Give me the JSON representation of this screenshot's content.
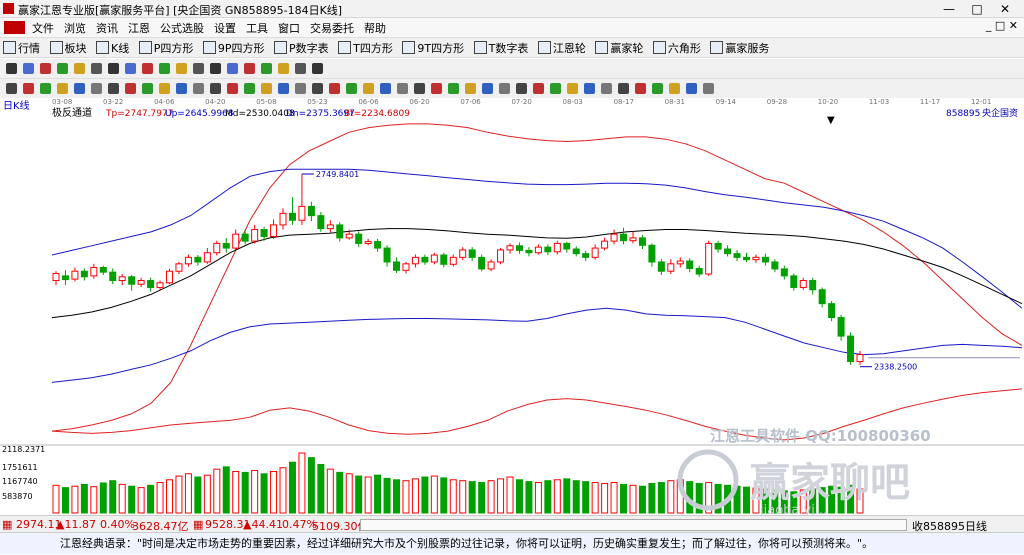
{
  "window": {
    "title": "赢家江恩专业版[赢家服务平台]  [央企国资  GN858895-184日K线]"
  },
  "menu": {
    "items": [
      "文件",
      "浏览",
      "资讯",
      "江恩",
      "公式选股",
      "设置",
      "工具",
      "窗口",
      "交易委托",
      "帮助"
    ]
  },
  "toolbar1": {
    "items": [
      "行情",
      "板块",
      "K线",
      "P四方形",
      "9P四方形",
      "P数字表",
      "T四方形",
      "9T四方形",
      "T数字表",
      "江恩轮",
      "赢家轮",
      "六角形",
      "赢家服务"
    ]
  },
  "colors": {
    "up": "#ff0000",
    "down": "#00a000",
    "band_outer": "#e02020",
    "band_inner": "#1818c8",
    "mid": "#000000",
    "info_tp": "#d40000",
    "info_up": "#0000d0",
    "info_md": "#000000",
    "info_dn": "#0000d0",
    "info_bt": "#d40000",
    "code": "#0000b0"
  },
  "header": {
    "period": "日K线",
    "indicator": "极反通道",
    "tp": "Tp=2747.7977",
    "up": "Up=2645.9968",
    "md": "Md=2530.0408",
    "dn": "Dn=2375.3697",
    "bt": "Bt=2234.6809",
    "code": "858895",
    "name": "央企国资"
  },
  "watermark": {
    "line1": "江恩工具软件 QQ:100800360",
    "line2": "赢家聊吧",
    "line3": "jiaoba.yj..."
  },
  "statusbar": {
    "idx1_value": "2974.11",
    "idx1_change": "▲11.87",
    "idx1_pct": "0.40%",
    "idx1_amount": "3628.47亿",
    "idx2_value": "9528.31",
    "idx2_change": "▲44.41",
    "idx2_pct": "0.47%",
    "idx2_amount": "5109.30亿",
    "right_label": "收858895日线"
  },
  "quote": {
    "text": "江恩经典语录：\"时间是决定市场走势的重要因素，经过详细研究大市及个别股票的过往记录，你将可以证明，历史确实重复发生；而了解过往，你将可以预测将来。\"。"
  },
  "chart_data": {
    "type": "candlestick",
    "date_ticks": [
      "03-08",
      "03-22",
      "04-06",
      "04-20",
      "05-08",
      "05-23",
      "06-06",
      "06-20",
      "07-06",
      "07-20",
      "08-03",
      "08-17",
      "08-31",
      "09-14",
      "09-28",
      "10-20",
      "11-03",
      "11-17",
      "12-01"
    ],
    "y_range": [
      2180,
      2860
    ],
    "price_annotations": [
      {
        "label": "2749.8401",
        "value": 2749.8401
      },
      {
        "label": "2338.2500",
        "value": 2338.25
      }
    ],
    "volume_axis_labels": [
      "2118.2371",
      "1751611",
      "1167740",
      "583870"
    ],
    "volume_max": 2118000,
    "series_tp": [
      2195,
      2200,
      2208,
      2218,
      2232,
      2255,
      2300,
      2380,
      2470,
      2560,
      2650,
      2720,
      2770,
      2800,
      2820,
      2840,
      2850,
      2855,
      2858,
      2858,
      2855,
      2850,
      2840,
      2832,
      2826,
      2822,
      2820,
      2822,
      2826,
      2830,
      2830,
      2825,
      2815,
      2800,
      2780,
      2760,
      2740,
      2730,
      2710,
      2690,
      2670,
      2650,
      2625,
      2595,
      2560,
      2520,
      2480,
      2440,
      2405,
      2380
    ],
    "series_up": [
      2575,
      2585,
      2595,
      2605,
      2615,
      2625,
      2640,
      2660,
      2690,
      2720,
      2745,
      2755,
      2760,
      2760,
      2760,
      2760,
      2758,
      2754,
      2750,
      2746,
      2742,
      2738,
      2734,
      2731,
      2728,
      2727,
      2727,
      2728,
      2730,
      2730,
      2729,
      2726,
      2720,
      2712,
      2705,
      2700,
      2694,
      2688,
      2683,
      2678,
      2670,
      2660,
      2648,
      2630,
      2612,
      2590,
      2560,
      2528,
      2495,
      2460
    ],
    "series_md": [
      2440,
      2445,
      2452,
      2462,
      2475,
      2490,
      2510,
      2530,
      2555,
      2580,
      2600,
      2612,
      2618,
      2620,
      2622,
      2626,
      2630,
      2632,
      2632,
      2630,
      2627,
      2623,
      2620,
      2618,
      2615,
      2612,
      2611,
      2614,
      2620,
      2625,
      2628,
      2630,
      2630,
      2628,
      2625,
      2622,
      2620,
      2618,
      2615,
      2610,
      2605,
      2598,
      2588,
      2575,
      2562,
      2548,
      2530,
      2510,
      2490,
      2470
    ],
    "series_dn": [
      2300,
      2305,
      2310,
      2318,
      2328,
      2338,
      2352,
      2368,
      2390,
      2408,
      2420,
      2426,
      2428,
      2430,
      2432,
      2434,
      2436,
      2437,
      2438,
      2438,
      2437,
      2436,
      2435,
      2433,
      2432,
      2438,
      2448,
      2456,
      2460,
      2456,
      2448,
      2445,
      2444,
      2442,
      2440,
      2430,
      2415,
      2400,
      2385,
      2375,
      2365,
      2360,
      2362,
      2368,
      2374,
      2380,
      2382,
      2380,
      2378,
      2375
    ],
    "series_bt": [
      2195,
      2192,
      2190,
      2192,
      2196,
      2202,
      2208,
      2212,
      2215,
      2218,
      2225,
      2240,
      2245,
      2238,
      2225,
      2208,
      2196,
      2190,
      2188,
      2190,
      2195,
      2205,
      2218,
      2238,
      2252,
      2262,
      2265,
      2262,
      2255,
      2248,
      2240,
      2230,
      2218,
      2205,
      2195,
      2186,
      2180,
      2176,
      2180,
      2190,
      2205,
      2218,
      2232,
      2245,
      2255,
      2264,
      2272,
      2278,
      2282,
      2286
    ],
    "candles": [
      [
        2520,
        2535,
        2510,
        2540
      ],
      [
        2530,
        2522,
        2510,
        2542
      ],
      [
        2523,
        2540,
        2518,
        2548
      ],
      [
        2540,
        2528,
        2520,
        2546
      ],
      [
        2530,
        2548,
        2524,
        2556
      ],
      [
        2548,
        2538,
        2532,
        2552
      ],
      [
        2538,
        2520,
        2512,
        2546
      ],
      [
        2520,
        2528,
        2510,
        2534
      ],
      [
        2528,
        2512,
        2498,
        2532
      ],
      [
        2512,
        2520,
        2506,
        2526
      ],
      [
        2520,
        2505,
        2496,
        2526
      ],
      [
        2505,
        2515,
        2500,
        2520
      ],
      [
        2515,
        2540,
        2512,
        2545
      ],
      [
        2540,
        2556,
        2534,
        2560
      ],
      [
        2556,
        2570,
        2550,
        2576
      ],
      [
        2570,
        2560,
        2552,
        2575
      ],
      [
        2560,
        2580,
        2556,
        2590
      ],
      [
        2580,
        2600,
        2574,
        2606
      ],
      [
        2600,
        2590,
        2580,
        2612
      ],
      [
        2590,
        2620,
        2586,
        2630
      ],
      [
        2620,
        2605,
        2598,
        2630
      ],
      [
        2605,
        2630,
        2600,
        2640
      ],
      [
        2630,
        2615,
        2606,
        2636
      ],
      [
        2615,
        2640,
        2610,
        2652
      ],
      [
        2640,
        2665,
        2630,
        2676
      ],
      [
        2665,
        2650,
        2640,
        2700
      ],
      [
        2650,
        2680,
        2640,
        2750
      ],
      [
        2680,
        2660,
        2648,
        2690
      ],
      [
        2660,
        2632,
        2625,
        2668
      ],
      [
        2632,
        2640,
        2624,
        2650
      ],
      [
        2640,
        2612,
        2604,
        2646
      ],
      [
        2612,
        2620,
        2608,
        2630
      ],
      [
        2620,
        2600,
        2592,
        2626
      ],
      [
        2600,
        2604,
        2596,
        2610
      ],
      [
        2604,
        2590,
        2582,
        2610
      ],
      [
        2590,
        2560,
        2550,
        2596
      ],
      [
        2560,
        2542,
        2536,
        2570
      ],
      [
        2542,
        2556,
        2535,
        2560
      ],
      [
        2556,
        2570,
        2548,
        2576
      ],
      [
        2570,
        2560,
        2554,
        2576
      ],
      [
        2560,
        2575,
        2555,
        2580
      ],
      [
        2575,
        2555,
        2548,
        2580
      ],
      [
        2555,
        2570,
        2550,
        2576
      ],
      [
        2570,
        2586,
        2564,
        2592
      ],
      [
        2586,
        2570,
        2562,
        2592
      ],
      [
        2570,
        2545,
        2540,
        2576
      ],
      [
        2545,
        2560,
        2540,
        2566
      ],
      [
        2560,
        2586,
        2555,
        2590
      ],
      [
        2586,
        2595,
        2578,
        2600
      ],
      [
        2595,
        2585,
        2578,
        2602
      ],
      [
        2585,
        2580,
        2572,
        2592
      ],
      [
        2580,
        2592,
        2576,
        2598
      ],
      [
        2592,
        2582,
        2575,
        2598
      ],
      [
        2582,
        2600,
        2576,
        2606
      ],
      [
        2600,
        2588,
        2580,
        2604
      ],
      [
        2588,
        2578,
        2572,
        2594
      ],
      [
        2578,
        2570,
        2562,
        2584
      ],
      [
        2570,
        2590,
        2565,
        2598
      ],
      [
        2590,
        2605,
        2585,
        2612
      ],
      [
        2605,
        2620,
        2598,
        2630
      ],
      [
        2620,
        2606,
        2598,
        2634
      ],
      [
        2606,
        2612,
        2600,
        2626
      ],
      [
        2612,
        2596,
        2588,
        2618
      ],
      [
        2596,
        2560,
        2550,
        2600
      ],
      [
        2560,
        2540,
        2532,
        2566
      ],
      [
        2540,
        2556,
        2534,
        2566
      ],
      [
        2556,
        2562,
        2548,
        2570
      ],
      [
        2562,
        2546,
        2538,
        2568
      ],
      [
        2546,
        2534,
        2528,
        2552
      ],
      [
        2534,
        2600,
        2530,
        2606
      ],
      [
        2600,
        2588,
        2580,
        2606
      ],
      [
        2588,
        2578,
        2572,
        2596
      ],
      [
        2578,
        2570,
        2562,
        2586
      ],
      [
        2570,
        2565,
        2560,
        2580
      ],
      [
        2565,
        2570,
        2558,
        2576
      ],
      [
        2570,
        2560,
        2552,
        2578
      ],
      [
        2560,
        2545,
        2538,
        2566
      ],
      [
        2545,
        2530,
        2522,
        2552
      ],
      [
        2530,
        2505,
        2498,
        2535
      ],
      [
        2505,
        2520,
        2500,
        2526
      ],
      [
        2520,
        2500,
        2490,
        2526
      ],
      [
        2500,
        2470,
        2462,
        2505
      ],
      [
        2470,
        2440,
        2432,
        2476
      ],
      [
        2440,
        2400,
        2390,
        2446
      ],
      [
        2400,
        2345,
        2338,
        2408
      ],
      [
        2345,
        2360,
        2338,
        2368
      ]
    ],
    "volumes": [
      60,
      55,
      58,
      62,
      57,
      65,
      70,
      62,
      58,
      55,
      60,
      66,
      72,
      80,
      85,
      78,
      82,
      95,
      100,
      90,
      88,
      92,
      85,
      90,
      98,
      110,
      130,
      120,
      105,
      95,
      88,
      85,
      80,
      78,
      82,
      75,
      72,
      70,
      74,
      78,
      80,
      76,
      72,
      70,
      68,
      66,
      70,
      74,
      78,
      72,
      68,
      66,
      70,
      72,
      74,
      70,
      68,
      66,
      64,
      66,
      62,
      60,
      58,
      64,
      66,
      70,
      72,
      68,
      64,
      66,
      62,
      60,
      58,
      56,
      54,
      52,
      50,
      48,
      46,
      50,
      52,
      55,
      58,
      56,
      60,
      52
    ]
  }
}
